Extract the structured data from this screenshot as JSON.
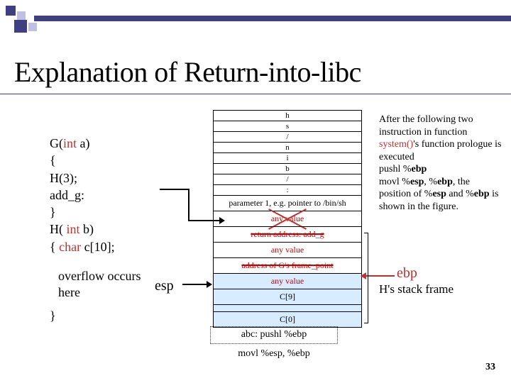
{
  "title": "Explanation of Return-into-libc",
  "code": {
    "line1a": "G(",
    "line1b": "int",
    "line1c": " a)",
    "line2": "{",
    "line3": "  H(3);",
    "line4": "  add_g:",
    "line5": "}",
    "line6a": "H( ",
    "line6b": "int",
    "line6c": " b)",
    "line7a": "{ ",
    "line7b": "char",
    "line7c": " c[10];",
    "close": "}"
  },
  "overflow_note1": "overflow occurs",
  "overflow_note2": "here",
  "esp_label": "esp",
  "stack_top": [
    "h",
    "s",
    "/",
    "n",
    "i",
    "b",
    "/"
  ],
  "stack_dots": ":",
  "stack_param": "parameter 1, e.g. pointer to /bin/sh",
  "stack_any1": "any value",
  "stack_ret": "return address: add_g",
  "stack_any2": "any value",
  "stack_frame": "address of G's frame_point",
  "stack_any3": "any value",
  "stack_c9": "C[9]",
  "stack_c0": "C[0]",
  "right": {
    "t1": "After the following two instruction in function ",
    "t2": "system()",
    "t3": "'s function prologue is executed",
    "l1a": "pushl   %",
    "l1b": "ebp",
    "l2a": "movl    %",
    "l2b": "esp",
    "l2c": ", %",
    "l2d": "ebp",
    "t4": ", the position of %",
    "t5": "esp",
    "t6": " and %",
    "t7": "ebp",
    "t8": " is shown in the figure."
  },
  "ebp_label": "ebp",
  "h_frame": "H's stack frame",
  "bottom1": "abc: pushl %ebp",
  "bottom2": "movl %esp, %ebp",
  "pagenum": "33"
}
